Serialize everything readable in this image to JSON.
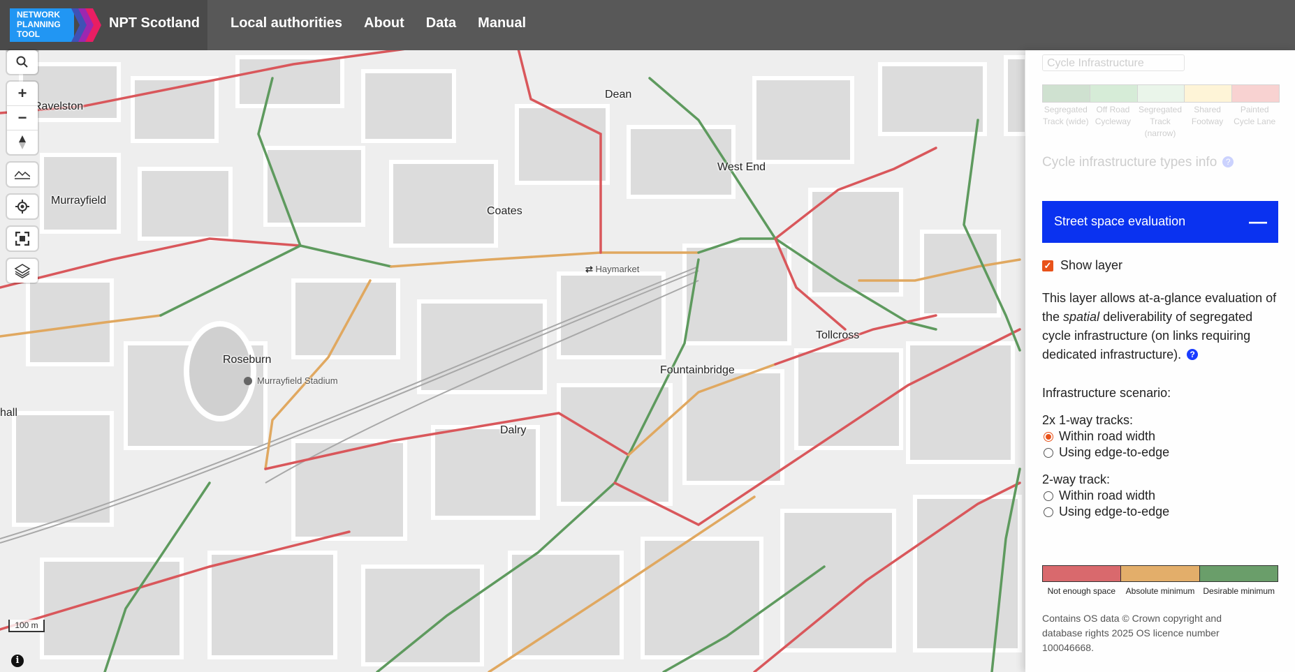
{
  "header": {
    "logo_text": "NETWORK PLANNING TOOL",
    "app_name": "NPT Scotland",
    "nav": [
      "Local authorities",
      "About",
      "Data",
      "Manual"
    ]
  },
  "map": {
    "places": {
      "dean": "Dean",
      "ravelston": "Ravelston",
      "murrayfield": "Murrayfield",
      "coates": "Coates",
      "west_end": "West End",
      "roseburn": "Roseburn",
      "fountainbridge": "Fountainbridge",
      "tollcross": "Tollcross",
      "dalry": "Dalry",
      "hall": "hall"
    },
    "pois": {
      "haymarket": "Haymarket",
      "murrayfield_stadium": "Murrayfield Stadium"
    },
    "scale_label": "100 m",
    "line_colors": {
      "not_enough": "#d9575b",
      "absolute": "#e0a860",
      "desirable": "#5e9a5e"
    }
  },
  "controls": {
    "icons": [
      "search-icon",
      "zoom-in-icon",
      "zoom-out-icon",
      "compass-icon",
      "terrain-icon",
      "locate-icon",
      "fullscreen-icon",
      "layers-icon",
      "info-icon"
    ],
    "zoom_in": "+",
    "zoom_out": "−",
    "info": "i"
  },
  "panel": {
    "layer_select": "Cycle Infrastructure",
    "ci_legend": {
      "colors": [
        "#2e7d32",
        "#4caf50",
        "#a5d6a7",
        "#ffd54f",
        "#e53935"
      ],
      "labels": [
        "Segregated Track (wide)",
        "Off Road Cycleway",
        "Segregated Track (narrow)",
        "Shared Footway",
        "Painted Cycle Lane"
      ]
    },
    "ci_info": "Cycle infrastructure types info",
    "ci_info_q": "?",
    "section_title": "Street space evaluation",
    "section_toggle": "—",
    "show_layer_label": "Show layer",
    "show_layer_checked": true,
    "desc_part1": "This layer allows at-a-glance evaluation of the ",
    "desc_em": "spatial",
    "desc_part2": " deliverability of segregated cycle infrastructure (on links requiring dedicated infrastructure).",
    "desc_q": "?",
    "scenario_heading": "Infrastructure scenario:",
    "group1_heading": "2x 1-way tracks:",
    "group1_options": [
      "Within road width",
      "Using edge-to-edge"
    ],
    "group2_heading": "2-way track:",
    "group2_options": [
      "Within road width",
      "Using edge-to-edge"
    ],
    "selected": "group1-0",
    "sse_legend": {
      "colors": [
        "#d9696d",
        "#e3ae6a",
        "#6a9e6a"
      ],
      "labels": [
        "Not enough space",
        "Absolute minimum",
        "Desirable minimum"
      ]
    },
    "attribution": "Contains OS data © Crown copyright and database rights 2025 OS licence number 100046668."
  }
}
